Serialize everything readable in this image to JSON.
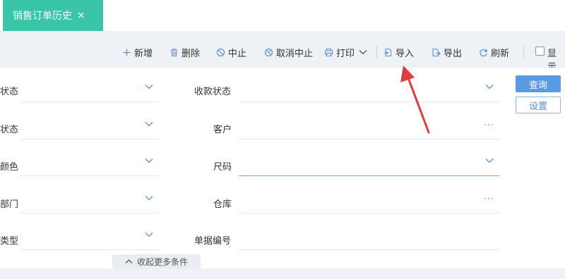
{
  "tab": {
    "title": "销售订单历史",
    "close": "×"
  },
  "toolbar": {
    "new": "新增",
    "delete": "删除",
    "stop": "中止",
    "cancel_stop": "取消中止",
    "print": "打印",
    "import": "导入",
    "export": "导出",
    "refresh": "刷新",
    "show": "显示"
  },
  "form": {
    "row1_left": "状态",
    "row1_right": "收款状态",
    "row2_left": "状态",
    "row2_right": "客户",
    "row3_left": "颜色",
    "row3_right": "尺码",
    "row4_left": "部门",
    "row4_right": "仓库",
    "row5_left": "类型",
    "row5_right": "单据编号",
    "dots": "···"
  },
  "actions": {
    "query": "查询",
    "settings": "设置",
    "collapse": "收起更多条件"
  },
  "colors": {
    "tab": "#3bc5a8",
    "primary": "#5b9ae0",
    "arrow": "#e23b3b"
  }
}
